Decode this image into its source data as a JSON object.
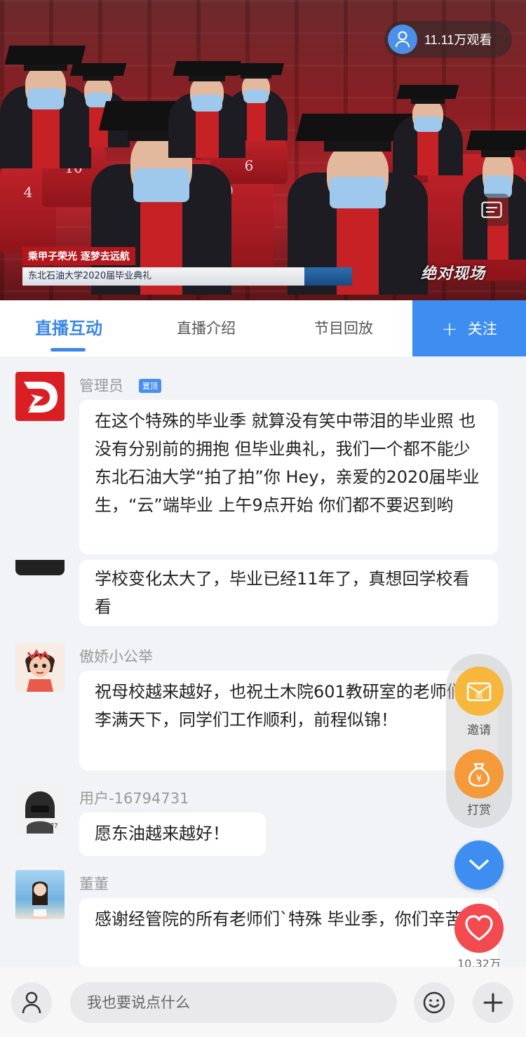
{
  "video": {
    "viewer_count": "11.11万观看",
    "slogan": "乘甲子荣光 逐梦去远航",
    "caption": "东北石油大学2020届毕业典礼",
    "logo_text": "绝对现场",
    "seat_numbers": [
      "10",
      "4",
      "10",
      "6"
    ]
  },
  "tabs": [
    {
      "label": "直播互动",
      "active": true
    },
    {
      "label": "直播介绍",
      "active": false
    },
    {
      "label": "节目回放",
      "active": false
    }
  ],
  "follow_button": {
    "label": "关注"
  },
  "messages": [
    {
      "name": "管理员",
      "badge": "置顶",
      "text": "在这个特殊的毕业季 就算没有笑中带泪的毕业照 也没有分别前的拥抱 但毕业典礼，我们一个都不能少 东北石油大学“拍了拍”你 Hey，亲爱的2020届毕业生，“云”端毕业 上午9点开始 你们都不要迟到哟"
    },
    {
      "name": "",
      "badge": "",
      "text": "学校变化太大了，毕业已经11年了，真想回学校看看"
    },
    {
      "name": "傲娇小公举",
      "badge": "",
      "text": "祝母校越来越好，也祝土木院601教研室的老师们桃李满天下，同学们工作顺利，前程似锦！"
    },
    {
      "name": "用户-16794731",
      "badge": "",
      "text": "愿东油越来越好！"
    },
    {
      "name": "董董",
      "badge": "",
      "text": "感谢经管院的所有老师们`特殊 毕业季，你们辛苦了"
    }
  ],
  "side_actions": {
    "invite": {
      "label": "邀请",
      "icon_text": "邀"
    },
    "reward": {
      "label": "打赏",
      "icon_text": "¥"
    }
  },
  "like_count": "10.32万",
  "input": {
    "placeholder": "我也要说点什么"
  },
  "colors": {
    "accent": "#3d8ef0",
    "like": "#f24a4f",
    "invite": "#f7b73c",
    "reward": "#f59a3a"
  }
}
